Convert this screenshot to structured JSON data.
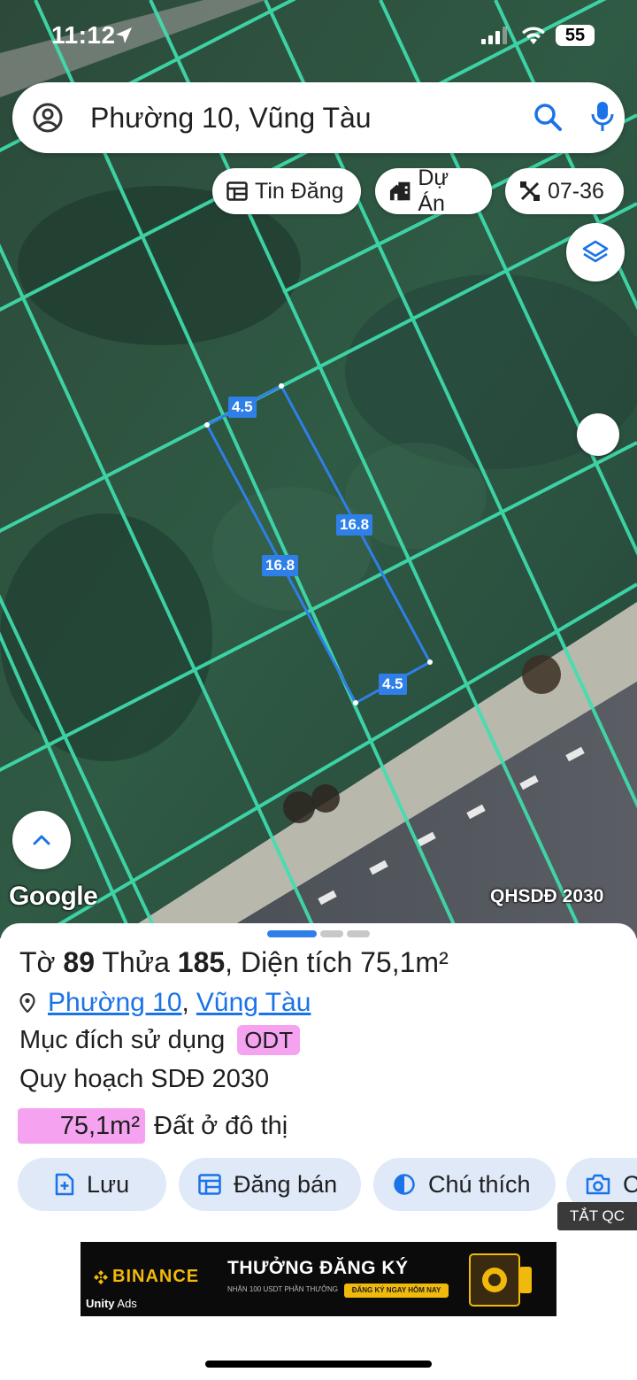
{
  "status_bar": {
    "time": "11:12",
    "battery": "55",
    "icons": [
      "location-arrow-icon",
      "cellular-signal-icon",
      "wifi-icon",
      "battery-icon"
    ]
  },
  "search": {
    "query": "Phường 10, Vũng Tàu",
    "icons": [
      "account-icon",
      "search-icon",
      "mic-icon"
    ]
  },
  "chips": [
    {
      "label": "Tin Đăng",
      "icon": "listing-icon"
    },
    {
      "label": "Dự Án",
      "icon": "building-icon"
    },
    {
      "label": "07-36",
      "icon": "tools-icon"
    }
  ],
  "map": {
    "attribution": "Google",
    "layer_label": "QHSDĐ 2030",
    "dimensions": {
      "top": "4.5",
      "right": "16.8",
      "left": "16.8",
      "bottom": "4.5"
    },
    "colors": {
      "grid": "#3fe0b0",
      "parcel": "#2f7fe8"
    }
  },
  "sheet": {
    "title_prefix": "Tờ",
    "sheet_no": "89",
    "parcel_word": "Thửa",
    "parcel_no": "185",
    "area_label": "Diện tích",
    "area": "75,1m²",
    "ward": "Phường 10",
    "separator": ",",
    "city": "Vũng Tàu",
    "purpose_label": "Mục đích sử dụng",
    "purpose_code": "ODT",
    "plan": "Quy hoạch SDĐ 2030",
    "area_badge": "75,1m²",
    "land_type": "Đất ở đô thị",
    "colors": {
      "badge": "#f5a3f0",
      "link": "#1a73e8",
      "button_bg": "#dfe9f8"
    }
  },
  "actions": [
    {
      "label": "Lưu",
      "icon": "save-icon"
    },
    {
      "label": "Đăng bán",
      "icon": "post-sale-icon"
    },
    {
      "label": "Chú thích",
      "icon": "legend-icon"
    },
    {
      "label": "C",
      "icon": "camera-icon"
    }
  ],
  "ads": {
    "hide_label": "TẮT QC",
    "brand": "BINANCE",
    "network": "Unity",
    "network_suffix": "Ads",
    "headline": "THƯỞNG ĐĂNG KÝ",
    "sub": "NHẬN 100 USDT PHẦN THƯỞNG",
    "cta": "ĐĂNG KÝ NGAY HÔM NAY"
  }
}
